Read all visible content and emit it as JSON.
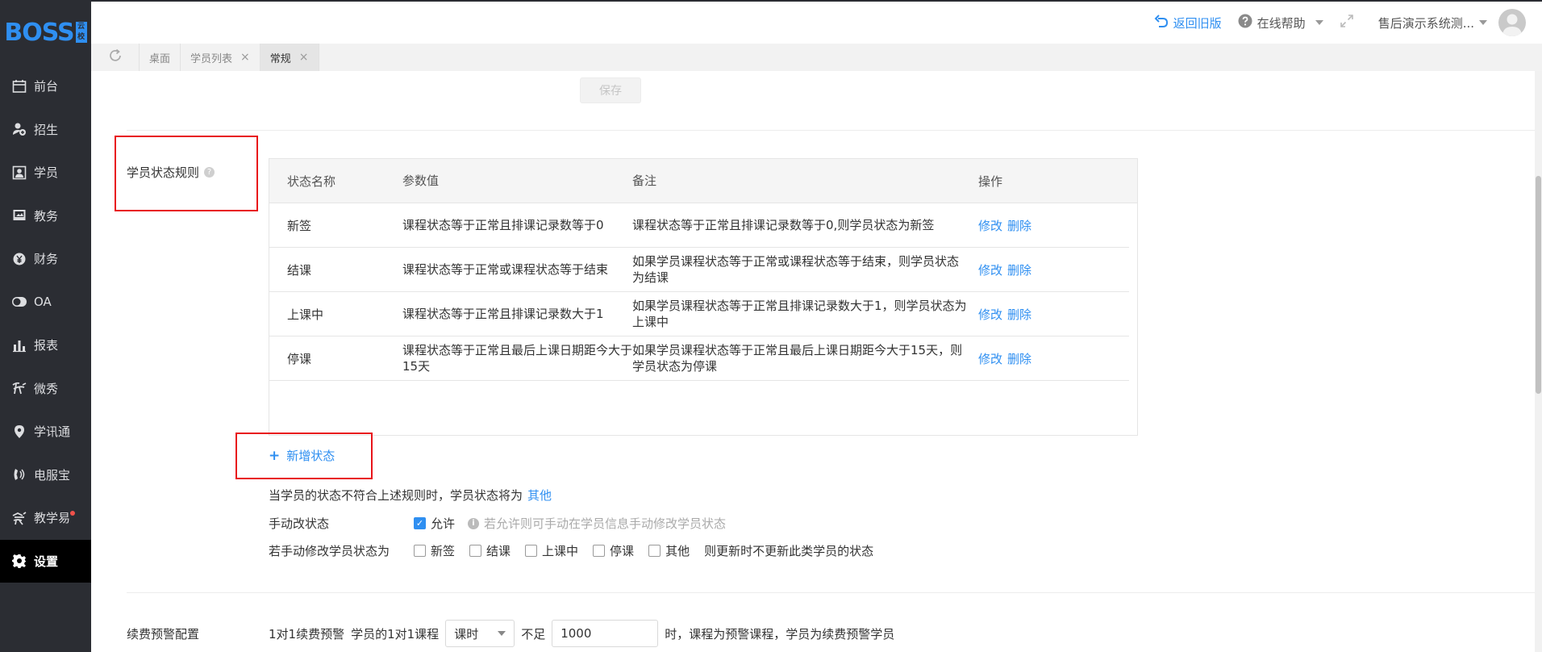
{
  "logo": {
    "text": "BOSS",
    "badge": "云校"
  },
  "sidebar": {
    "items": [
      {
        "label": "前台",
        "icon": "calendar-icon"
      },
      {
        "label": "招生",
        "icon": "add-user-icon"
      },
      {
        "label": "学员",
        "icon": "student-icon"
      },
      {
        "label": "教务",
        "icon": "book-icon"
      },
      {
        "label": "财务",
        "icon": "yen-icon"
      },
      {
        "label": "OA",
        "icon": "toggle-icon"
      },
      {
        "label": "报表",
        "icon": "bar-chart-icon"
      },
      {
        "label": "微秀",
        "icon": "weixiu-icon"
      },
      {
        "label": "学讯通",
        "icon": "location-icon"
      },
      {
        "label": "电服宝",
        "icon": "phone-service-icon"
      },
      {
        "label": "教学易",
        "icon": "teach-icon"
      },
      {
        "label": "设置",
        "icon": "gear-icon"
      }
    ],
    "active": "设置"
  },
  "header": {
    "back_old": "返回旧版",
    "help": "在线帮助",
    "user": "售后演示系统测..."
  },
  "tabs": [
    {
      "label": "桌面",
      "closable": false
    },
    {
      "label": "学员列表",
      "closable": true
    },
    {
      "label": "常规",
      "closable": true,
      "active": true
    }
  ],
  "content": {
    "save_button": "保存",
    "student_status_rule": {
      "label": "学员状态规则",
      "columns": [
        "状态名称",
        "参数值",
        "备注",
        "操作"
      ],
      "rows": [
        {
          "name": "新签",
          "param": "课程状态等于正常且排课记录数等于0",
          "remark": "课程状态等于正常且排课记录数等于0,则学员状态为新签"
        },
        {
          "name": "结课",
          "param": "课程状态等于正常或课程状态等于结束",
          "remark": "如果学员课程状态等于正常或课程状态等于结束，则学员状态为结课"
        },
        {
          "name": "上课中",
          "param": "课程状态等于正常且排课记录数大于1",
          "remark": "如果学员课程状态等于正常且排课记录数大于1，则学员状态为上课中"
        },
        {
          "name": "停课",
          "param": "课程状态等于正常且最后上课日期距今大于15天",
          "remark": "如果学员课程状态等于正常且最后上课日期距今大于15天，则学员状态为停课"
        }
      ],
      "edit_label": "修改",
      "delete_label": "删除"
    },
    "add_state": "新增状态",
    "fallback_text": "当学员的状态不符合上述规则时，学员状态将为",
    "fallback_value": "其他",
    "manual_change": {
      "label": "手动改状态",
      "allow_label": "允许",
      "allow_checked": true,
      "hint": "若允许则可手动在学员信息手动修改学员状态"
    },
    "manual_set": {
      "label": "若手动修改学员状态为",
      "options": [
        "新签",
        "结课",
        "上课中",
        "停课",
        "其他"
      ],
      "suffix": "则更新时不更新此类学员的状态"
    },
    "renewal": {
      "label": "续费预警配置",
      "item": "1对1续费预警",
      "prefix": "学员的1对1课程",
      "unit": "课时",
      "middle": "不足",
      "value": "1000",
      "suffix": "时，课程为预警课程，学员为续费预警学员"
    }
  }
}
